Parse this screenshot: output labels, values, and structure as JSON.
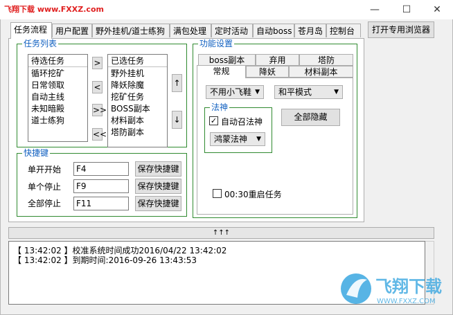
{
  "window": {
    "title": "飞翔下载 www.FXXZ.com",
    "controls": {
      "minimize": "—",
      "maximize": "☐",
      "close": "✕"
    }
  },
  "tabs": [
    "任务流程",
    "用户配置",
    "野外挂机/道士练狗",
    "满包处理",
    "定时活动",
    "自动boss",
    "苍月岛",
    "控制台"
  ],
  "open_browser_label": "打开专用浏览器",
  "task_list": {
    "title": "任务列表",
    "pending_header": "待选任务",
    "pending_items": [
      "循环挖矿",
      "日常领取",
      "自动主线",
      "未知暗殿",
      "道士练狗"
    ],
    "selected_header": "已选任务",
    "selected_items": [
      "野外挂机",
      "降妖除魔",
      "挖矿任务",
      "BOSS副本",
      "材料副本",
      "塔防副本"
    ],
    "move_buttons": [
      ">",
      "<",
      ">>",
      "<<"
    ],
    "order_buttons": [
      "↑",
      "↓"
    ]
  },
  "hotkeys": {
    "title": "快捷键",
    "rows": [
      {
        "label": "单开开始",
        "value": "F4",
        "button": "保存快捷键"
      },
      {
        "label": "单个停止",
        "value": "F9",
        "button": "保存快捷键"
      },
      {
        "label": "全部停止",
        "value": "F11",
        "button": "保存快捷键"
      }
    ]
  },
  "features": {
    "title": "功能设置",
    "subtabs_row1": [
      "boss副本",
      "弃用",
      "塔防"
    ],
    "subtabs_row2": [
      "常规",
      "降妖",
      "材料副本"
    ],
    "shoe_select": "不用小飞鞋",
    "mode_select": "和平模式",
    "divine": {
      "title": "法神",
      "auto_summon_label": "自动召法神",
      "auto_summon_checked": "✓",
      "type_select": "鸿蒙法神"
    },
    "hide_all_button": "全部隐藏",
    "restart_label": "00:30重启任务",
    "restart_checked": ""
  },
  "splitter_label": "↑↑↑",
  "log": [
    "【 13:42:02 】校准系统时间成功2016/04/22 13:42:02",
    "【 13:42:02 】到期时间:2016-09-26 13:43:53"
  ],
  "watermark": {
    "text": "飞翔下载",
    "url": "WWW.FXXZ.COM"
  }
}
